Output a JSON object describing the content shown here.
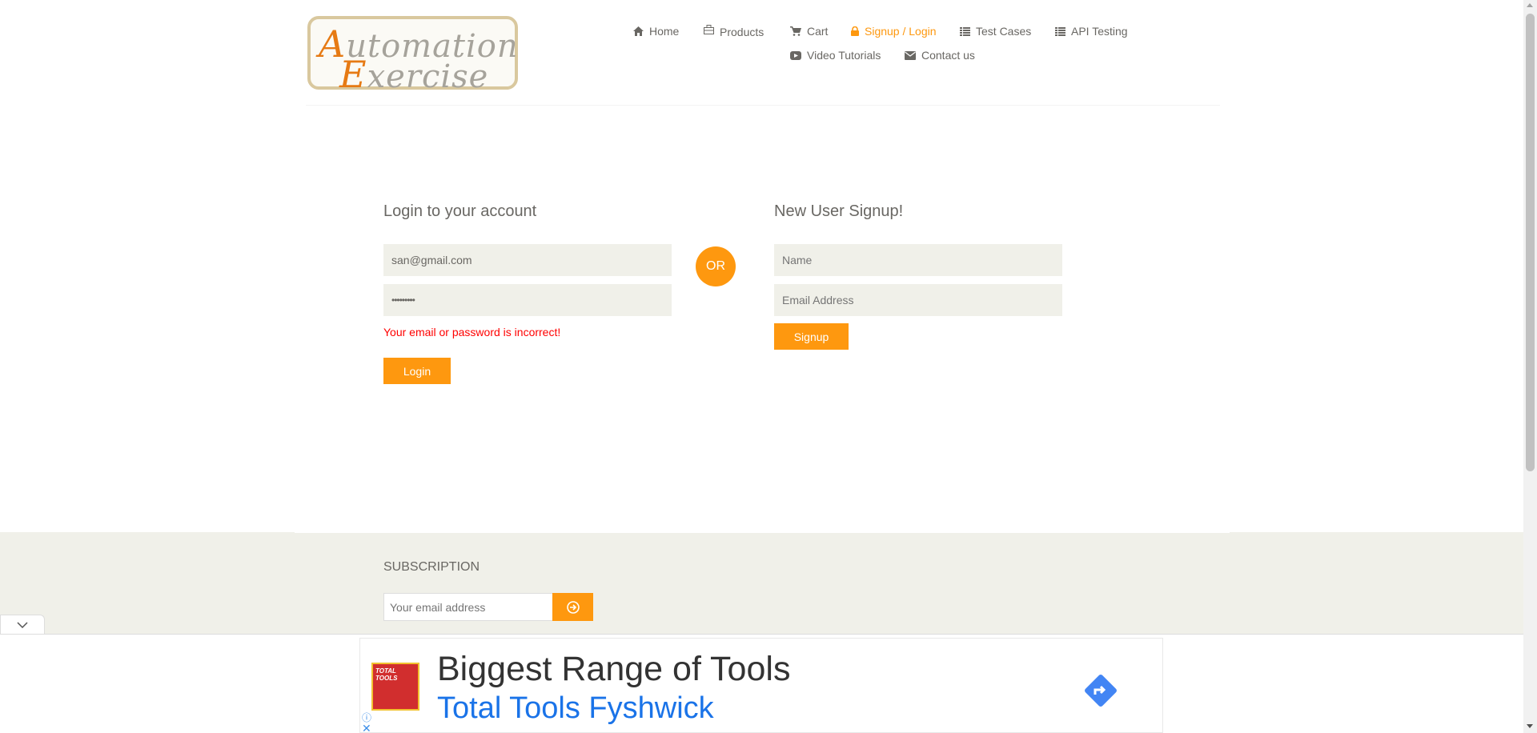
{
  "logo": {
    "line1_cap": "A",
    "line1_rest": "utomation",
    "line2_cap": "E",
    "line2_rest": "xercise"
  },
  "nav": {
    "items": [
      {
        "label": "Home",
        "icon": "home-icon"
      },
      {
        "label": "Products",
        "icon": "products-icon"
      },
      {
        "label": "Cart",
        "icon": "cart-icon"
      },
      {
        "label": "Signup / Login",
        "icon": "lock-icon",
        "active": true
      },
      {
        "label": "Test Cases",
        "icon": "list-icon"
      },
      {
        "label": "API Testing",
        "icon": "list-icon"
      },
      {
        "label": "Video Tutorials",
        "icon": "youtube-play-icon"
      },
      {
        "label": "Contact us",
        "icon": "envelope-icon"
      }
    ]
  },
  "login": {
    "title": "Login to your account",
    "email_value": "san@gmail.com",
    "password_value": "•••••••••",
    "error": "Your email or password is incorrect!",
    "button": "Login"
  },
  "or_label": "OR",
  "signup": {
    "title": "New User Signup!",
    "name_placeholder": "Name",
    "email_placeholder": "Email Address",
    "button": "Signup"
  },
  "footer": {
    "subscription_title": "SUBSCRIPTION",
    "email_placeholder": "Your email address"
  },
  "ad": {
    "headline": "Biggest Range of Tools",
    "subline": "Total Tools Fyshwick",
    "thumb_text": "TOTAL TOOLS",
    "info_icon": "ⓘ",
    "close_icon": "✕"
  },
  "colors": {
    "accent": "#fe980f",
    "error": "#ff0000",
    "field_bg": "#f0f0e9",
    "text": "#696763",
    "ad_link": "#1a73e8"
  }
}
